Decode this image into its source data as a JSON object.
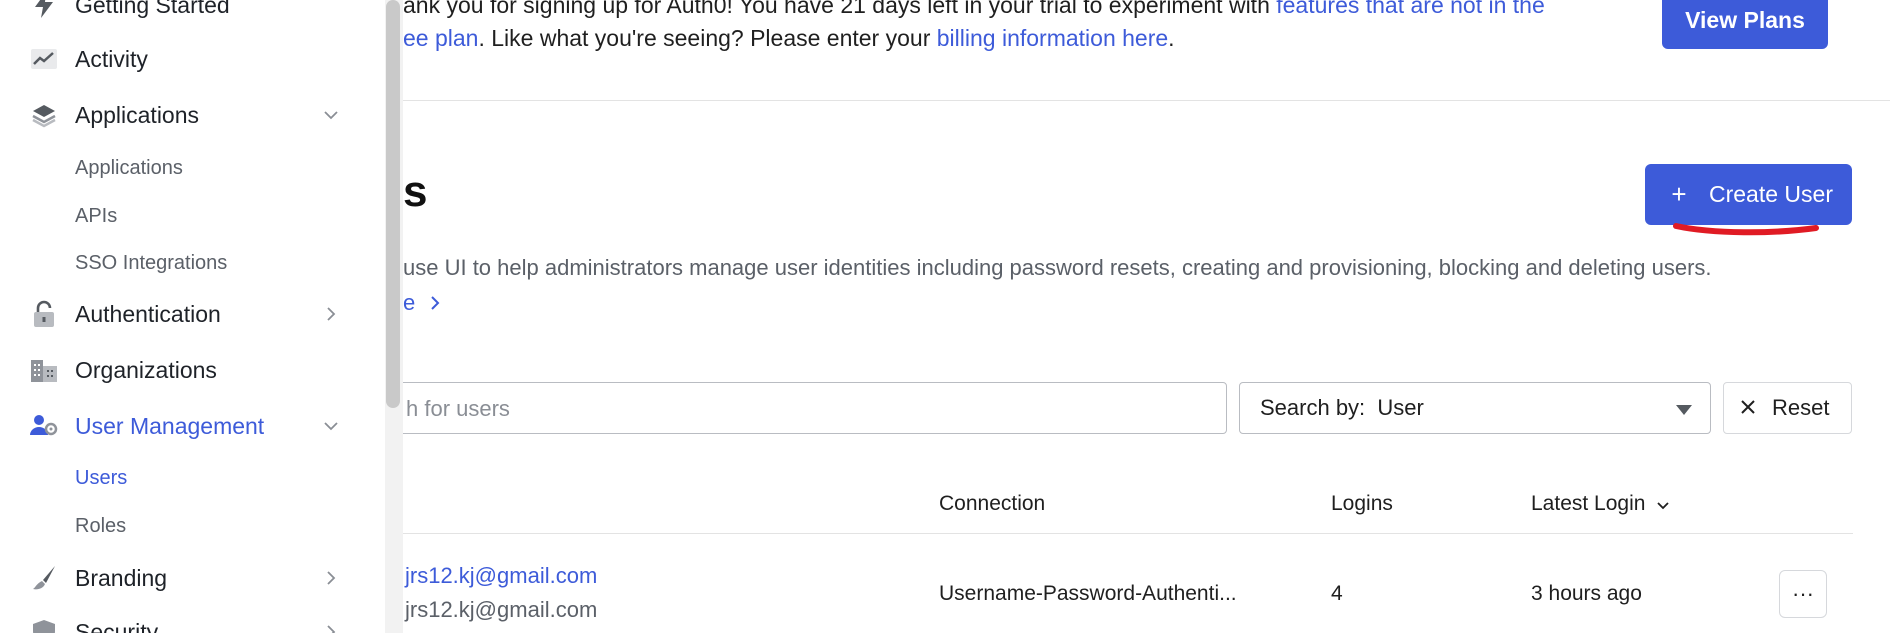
{
  "sidebar": {
    "items": [
      {
        "label": "Getting Started",
        "icon": "lightning-icon"
      },
      {
        "label": "Activity",
        "icon": "chart-trend-icon"
      },
      {
        "label": "Applications",
        "icon": "layers-icon",
        "expanded": true,
        "subitems": [
          "Applications",
          "APIs",
          "SSO Integrations"
        ]
      },
      {
        "label": "Authentication",
        "icon": "lock-icon"
      },
      {
        "label": "Organizations",
        "icon": "building-icon"
      },
      {
        "label": "User Management",
        "icon": "user-gear-icon",
        "expanded": true,
        "active": true,
        "subitems": [
          "Users",
          "Roles"
        ],
        "active_subitem": "Users"
      },
      {
        "label": "Branding",
        "icon": "brush-icon"
      },
      {
        "label": "Security",
        "icon": "shield-icon"
      }
    ]
  },
  "banner": {
    "line1_text": "ank you for signing up for Auth0! You have 21 days left in your trial to experiment with ",
    "line1_link": "features that are not in the",
    "line2_link": "ee plan",
    "line2_text": ". Like what you're seeing? Please enter your ",
    "line2_link2": "billing information here",
    "line2_end": ".",
    "view_plans_label": "View Plans"
  },
  "page": {
    "title": "s",
    "create_user_label": "Create User",
    "create_user_icon": "plus-icon",
    "description": "use UI to help administrators manage user identities including password resets, creating and provisioning, blocking and deleting users.",
    "learn_more": "e"
  },
  "search": {
    "placeholder": "h for users",
    "search_by_label": "Search by:  User",
    "reset_label": "Reset"
  },
  "table": {
    "headers": {
      "connection": "Connection",
      "logins": "Logins",
      "latest_login": "Latest Login"
    },
    "rows": [
      {
        "name": "jrs12.kj@gmail.com",
        "email": "jrs12.kj@gmail.com",
        "connection": "Username-Password-Authenti...",
        "logins": "4",
        "latest_login": "3 hours ago",
        "actions": "···"
      }
    ]
  },
  "colors": {
    "accent": "#3d5bd9",
    "annotation": "#e01b24"
  }
}
